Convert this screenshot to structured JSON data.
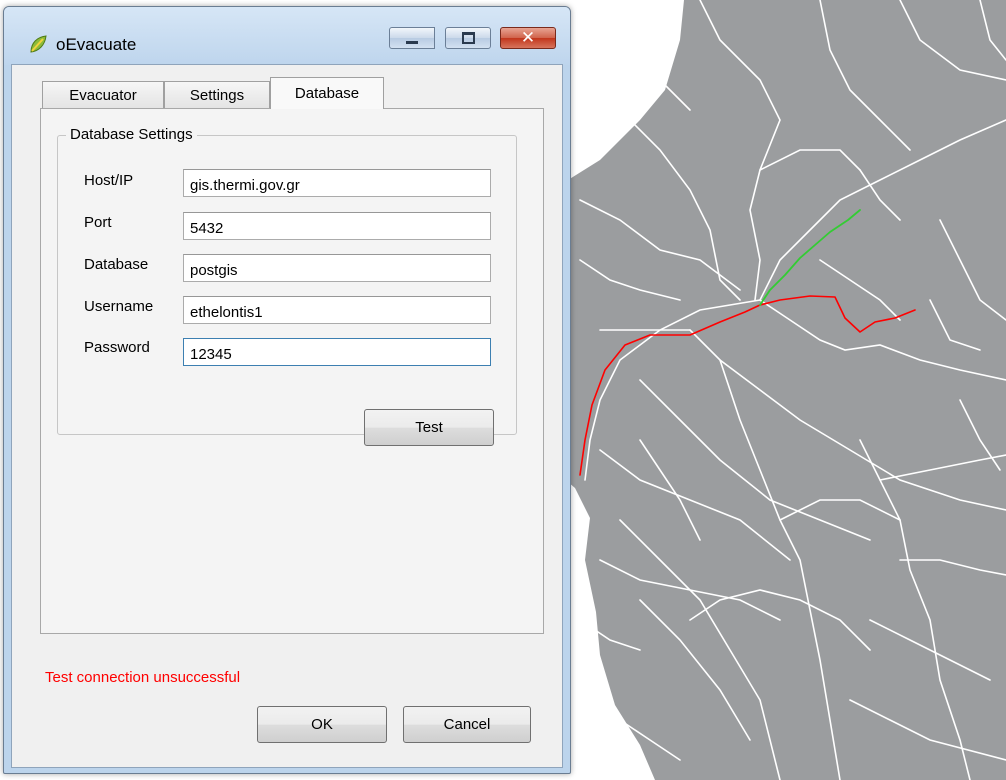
{
  "window": {
    "title": "oEvacuate",
    "controls": {
      "minimize": "minimize",
      "maximize": "maximize",
      "close": "close"
    }
  },
  "tabs": [
    {
      "label": "Evacuator",
      "active": false
    },
    {
      "label": "Settings",
      "active": false
    },
    {
      "label": "Database",
      "active": true
    }
  ],
  "database_settings": {
    "group_title": "Database Settings",
    "fields": {
      "host": {
        "label": "Host/IP",
        "value": "gis.thermi.gov.gr"
      },
      "port": {
        "label": "Port",
        "value": "5432"
      },
      "database": {
        "label": "Database",
        "value": "postgis"
      },
      "username": {
        "label": "Username",
        "value": "ethelontis1"
      },
      "password": {
        "label": "Password",
        "value": "12345"
      }
    },
    "test_button": "Test"
  },
  "status": {
    "message": "Test connection unsuccessful",
    "color": "#ff0000"
  },
  "buttons": {
    "ok": "OK",
    "cancel": "Cancel"
  },
  "map": {
    "land_color": "#9b9d9f",
    "road_color": "#ffffff",
    "route_colors": {
      "evacuation_route": "#ff0000",
      "secondary_route": "#33cc33"
    }
  },
  "icons": {
    "app": "qgis-leaf-icon"
  }
}
